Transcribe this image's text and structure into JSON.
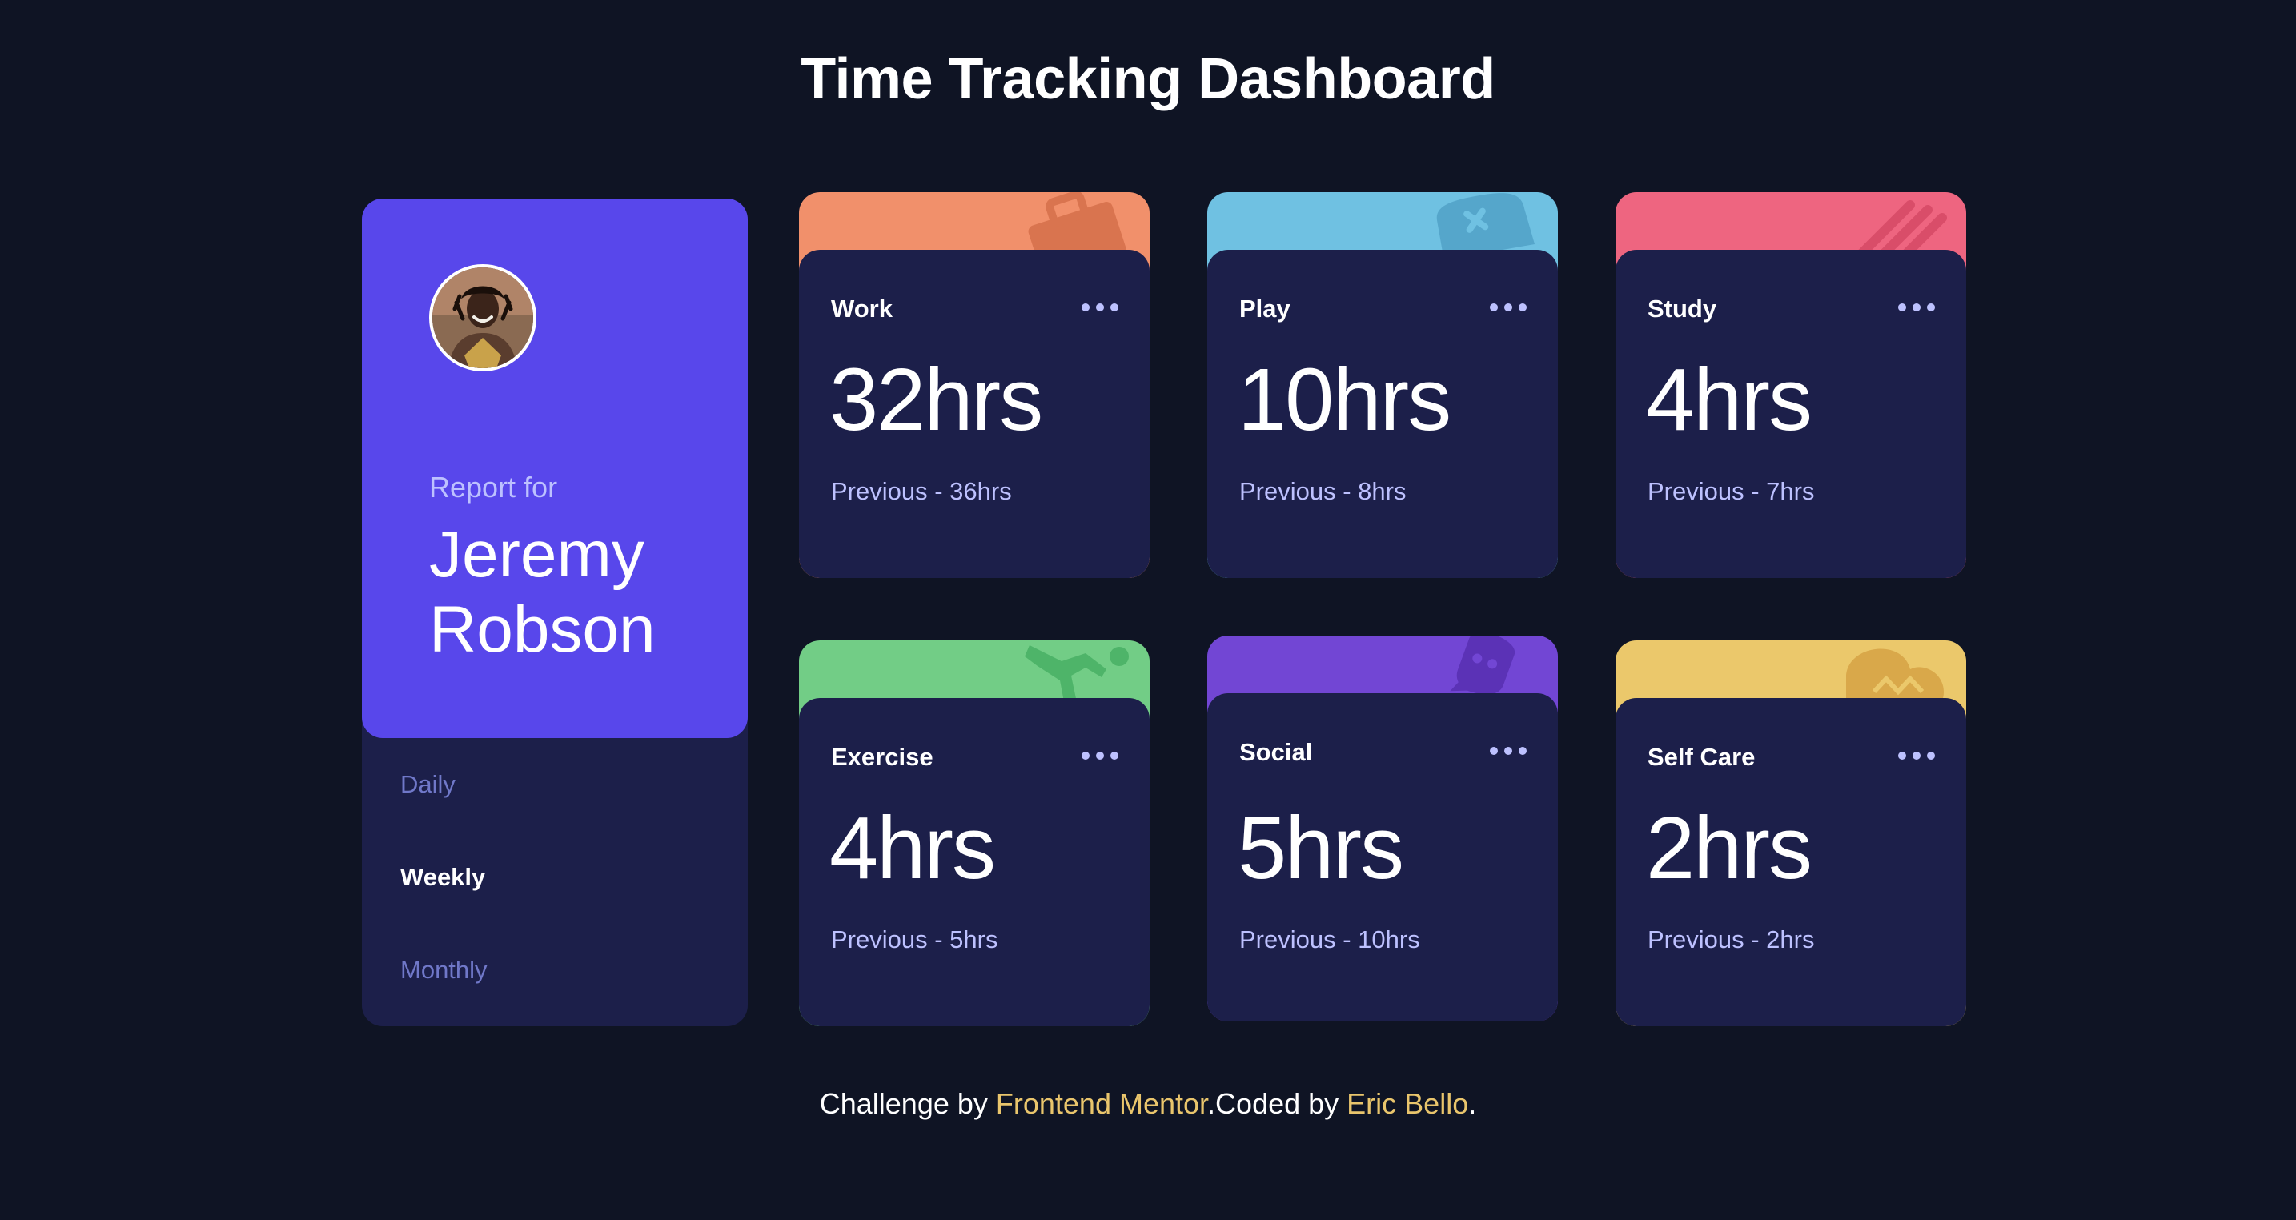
{
  "page": {
    "title": "Time Tracking Dashboard"
  },
  "profile": {
    "report_for": "Report for",
    "name_line1": "Jeremy",
    "name_line2": "Robson",
    "avatar_alt": "Jeremy Robson avatar"
  },
  "periods": {
    "daily": "Daily",
    "weekly": "Weekly",
    "monthly": "Monthly",
    "selected": "Weekly"
  },
  "cards": [
    {
      "title": "Work",
      "current": "32hrs",
      "previous": "Previous - 36hrs",
      "color": "#f1906b",
      "icon": "briefcase-icon"
    },
    {
      "title": "Play",
      "current": "10hrs",
      "previous": "Previous - 8hrs",
      "color": "#6fc1e2",
      "icon": "gamepad-icon"
    },
    {
      "title": "Study",
      "current": "4hrs",
      "previous": "Previous - 7hrs",
      "color": "#ee6580",
      "icon": "book-icon"
    },
    {
      "title": "Exercise",
      "current": "4hrs",
      "previous": "Previous - 5hrs",
      "color": "#72cd86",
      "icon": "running-icon"
    },
    {
      "title": "Social",
      "current": "5hrs",
      "previous": "Previous - 10hrs",
      "color": "#7246d4",
      "icon": "chat-icon"
    },
    {
      "title": "Self Care",
      "current": "2hrs",
      "previous": "Previous - 2hrs",
      "color": "#ebc86b",
      "icon": "heart-hand-icon"
    }
  ],
  "footer": {
    "prefix": "Challenge by ",
    "link1": "Frontend Mentor",
    "middle": ".Coded by ",
    "link2": "Eric Bello",
    "suffix": "."
  },
  "colors": {
    "background": "#0f1424",
    "card": "#1c1f4a",
    "profile_accent": "#5847eb",
    "link": "#e9c56c",
    "muted_text": "#bdc1ff",
    "inactive_period": "#7078c9"
  }
}
